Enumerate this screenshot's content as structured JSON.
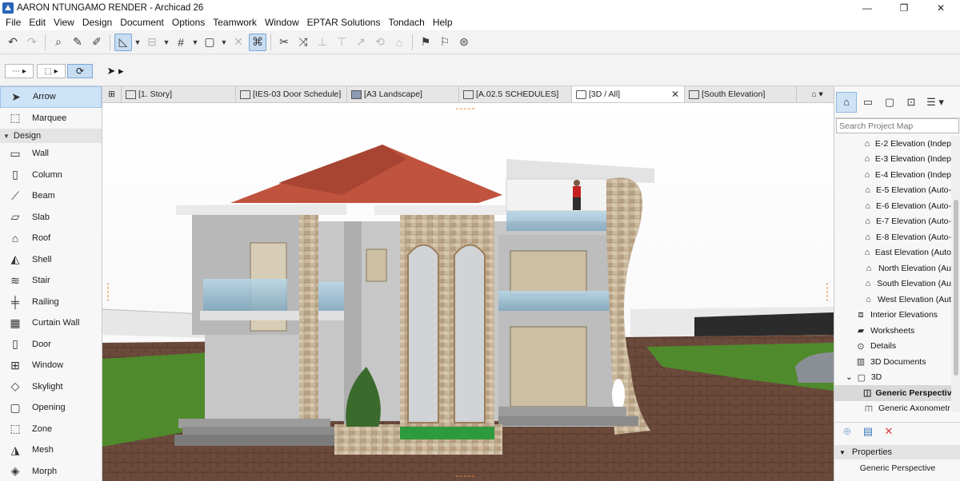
{
  "window": {
    "title": "AARON NTUNGAMO RENDER - Archicad 26",
    "minimize": "—",
    "restore": "❐",
    "close": "✕"
  },
  "menu": [
    "File",
    "Edit",
    "View",
    "Design",
    "Document",
    "Options",
    "Teamwork",
    "Window",
    "EPTAR Solutions",
    "Tondach",
    "Help"
  ],
  "toolbox": {
    "top_items": [
      {
        "label": "Arrow",
        "icon": "arrow-pointer-icon",
        "selected": true
      },
      {
        "label": "Marquee",
        "icon": "marquee-icon",
        "selected": false
      }
    ],
    "design_header": "Design",
    "design_items": [
      {
        "label": "Wall",
        "icon": "wall-icon"
      },
      {
        "label": "Column",
        "icon": "column-icon"
      },
      {
        "label": "Beam",
        "icon": "beam-icon"
      },
      {
        "label": "Slab",
        "icon": "slab-icon"
      },
      {
        "label": "Roof",
        "icon": "roof-icon"
      },
      {
        "label": "Shell",
        "icon": "shell-icon"
      },
      {
        "label": "Stair",
        "icon": "stair-icon"
      },
      {
        "label": "Railing",
        "icon": "railing-icon"
      },
      {
        "label": "Curtain Wall",
        "icon": "curtain-wall-icon"
      },
      {
        "label": "Door",
        "icon": "door-icon"
      },
      {
        "label": "Window",
        "icon": "window-icon"
      },
      {
        "label": "Skylight",
        "icon": "skylight-icon"
      },
      {
        "label": "Opening",
        "icon": "opening-icon"
      },
      {
        "label": "Zone",
        "icon": "zone-icon"
      },
      {
        "label": "Mesh",
        "icon": "mesh-icon"
      },
      {
        "label": "Morph",
        "icon": "morph-icon"
      }
    ]
  },
  "tabs": [
    {
      "label": "[1. Story]",
      "icon": "floor-plan-icon",
      "active": false
    },
    {
      "label": "[IES-03 Door Schedule]",
      "icon": "schedule-icon",
      "active": false
    },
    {
      "label": "[A3 Landscape]",
      "icon": "layout-icon",
      "active": false
    },
    {
      "label": "[A.02.5 SCHEDULES]",
      "icon": "drawing-icon",
      "active": false
    },
    {
      "label": "[3D / All]",
      "icon": "3d-view-icon",
      "active": true
    },
    {
      "label": "[South Elevation]",
      "icon": "elevation-icon",
      "active": false
    }
  ],
  "tab_close": "✕",
  "navigator": {
    "search_placeholder": "Search Project Map",
    "items": [
      {
        "label": "E-2 Elevation (Indep",
        "icon": "elevation-icon",
        "indent": 2
      },
      {
        "label": "E-3 Elevation (Indep",
        "icon": "elevation-icon",
        "indent": 2
      },
      {
        "label": "E-4 Elevation (Indep",
        "icon": "elevation-icon",
        "indent": 2
      },
      {
        "label": "E-5 Elevation (Auto-",
        "icon": "elevation-icon",
        "indent": 2
      },
      {
        "label": "E-6 Elevation (Auto-",
        "icon": "elevation-icon",
        "indent": 2
      },
      {
        "label": "E-7 Elevation (Auto-",
        "icon": "elevation-icon",
        "indent": 2
      },
      {
        "label": "E-8 Elevation (Auto-",
        "icon": "elevation-icon",
        "indent": 2
      },
      {
        "label": "East Elevation (Auto",
        "icon": "elevation-icon",
        "indent": 2
      },
      {
        "label": "North Elevation (Au",
        "icon": "elevation-icon",
        "indent": 2
      },
      {
        "label": "South Elevation (Au",
        "icon": "elevation-icon",
        "indent": 2
      },
      {
        "label": "West Elevation (Aut",
        "icon": "elevation-icon",
        "indent": 2
      },
      {
        "label": "Interior Elevations",
        "icon": "interior-elevation-icon",
        "indent": 1
      },
      {
        "label": "Worksheets",
        "icon": "worksheet-icon",
        "indent": 1
      },
      {
        "label": "Details",
        "icon": "details-icon",
        "indent": 1
      },
      {
        "label": "3D Documents",
        "icon": "3d-document-icon",
        "indent": 1
      },
      {
        "label": "3D",
        "icon": "3d-folder-icon",
        "indent": 0
      },
      {
        "label": "Generic Perspective",
        "icon": "perspective-icon",
        "indent": 2,
        "selected": true
      },
      {
        "label": "Generic Axonometr",
        "icon": "axonometry-icon",
        "indent": 2
      }
    ],
    "properties_header": "Properties",
    "properties_value": "Generic Perspective"
  }
}
